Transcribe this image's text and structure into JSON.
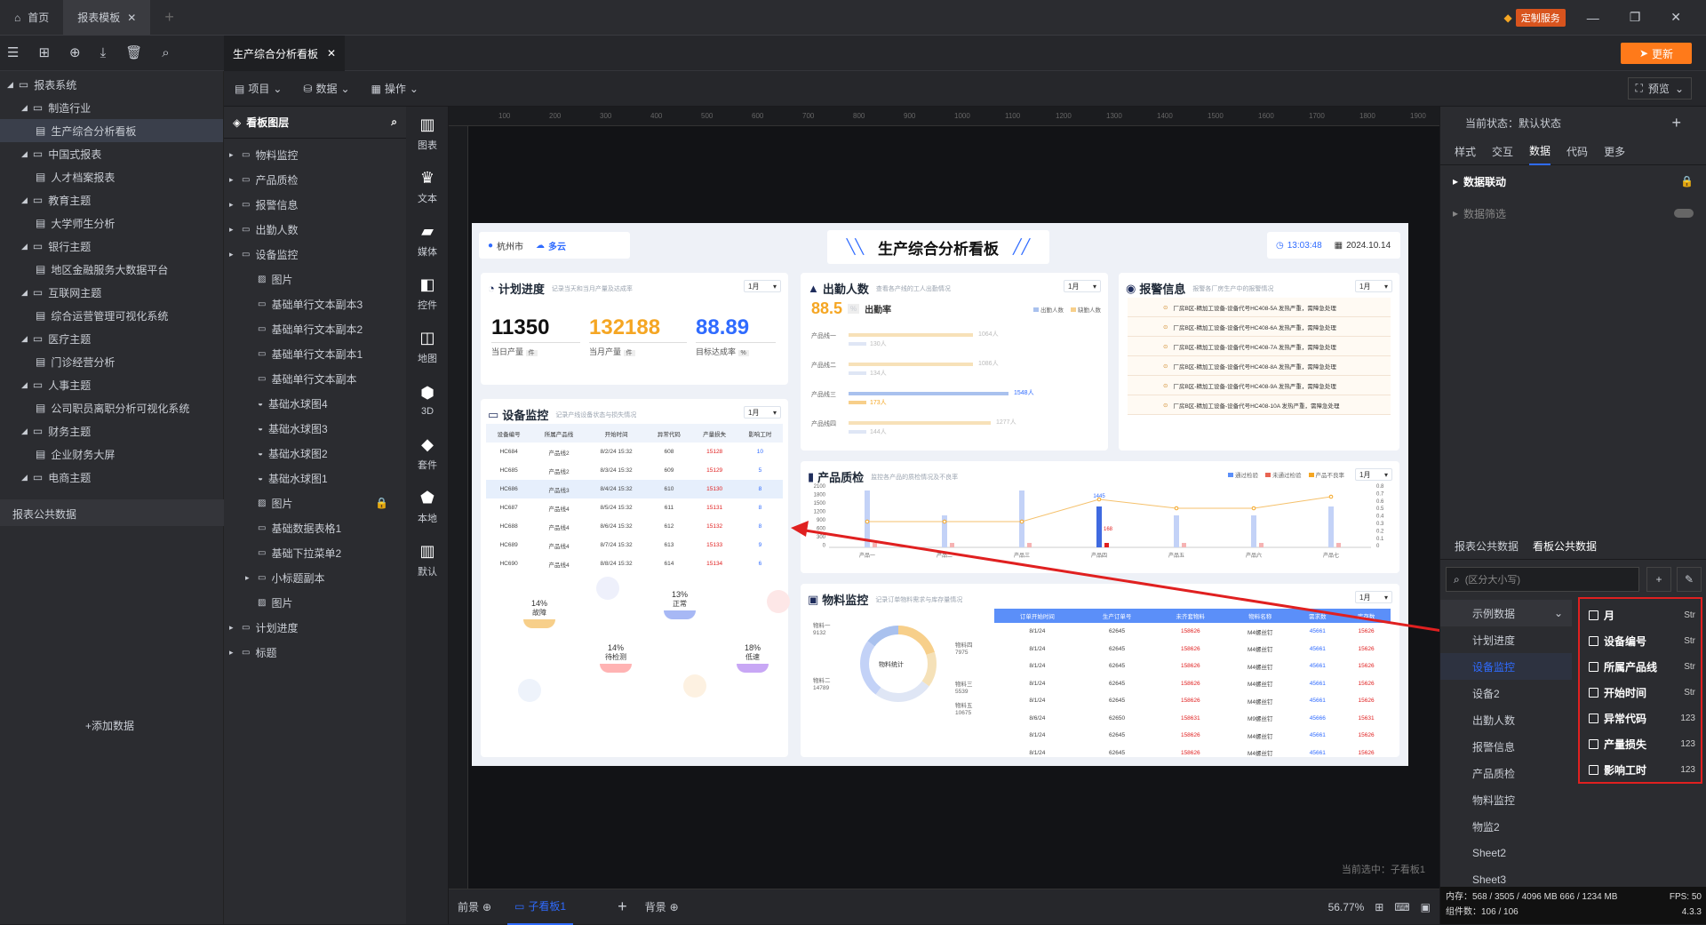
{
  "titlebar": {
    "tab_home": "首页",
    "tab_report": "报表模板",
    "custom_service": "定制服务"
  },
  "toolbar": {
    "doc_tab": "生产综合分析看板",
    "menu_project": "项目",
    "menu_data": "数据",
    "menu_operate": "操作",
    "update": "更新",
    "preview": "预览"
  },
  "tree": [
    {
      "label": "报表系统",
      "level": 0
    },
    {
      "label": "制造行业",
      "level": 1
    },
    {
      "label": "生产综合分析看板",
      "level": 2,
      "selected": true
    },
    {
      "label": "中国式报表",
      "level": 1
    },
    {
      "label": "人才档案报表",
      "level": 2
    },
    {
      "label": "教育主题",
      "level": 1
    },
    {
      "label": "大学师生分析",
      "level": 2
    },
    {
      "label": "银行主题",
      "level": 1
    },
    {
      "label": "地区金融服务大数据平台",
      "level": 2
    },
    {
      "label": "互联网主题",
      "level": 1
    },
    {
      "label": "综合运营管理可视化系统",
      "level": 2
    },
    {
      "label": "医疗主题",
      "level": 1
    },
    {
      "label": "门诊经营分析",
      "level": 2
    },
    {
      "label": "人事主题",
      "level": 1
    },
    {
      "label": "公司职员离职分析可视化系统",
      "level": 2
    },
    {
      "label": "财务主题",
      "level": 1
    },
    {
      "label": "企业财务大屏",
      "level": 2
    },
    {
      "label": "电商主题",
      "level": 1
    }
  ],
  "public_data": {
    "title": "报表公共数据",
    "add": "+添加数据"
  },
  "layers": {
    "title": "看板图层",
    "items": [
      "物料监控",
      "产品质检",
      "报警信息",
      "出勤人数",
      "设备监控",
      "图片",
      "基础单行文本副本3",
      "基础单行文本副本2",
      "基础单行文本副本1",
      "基础单行文本副本",
      "基础水球图4",
      "基础水球图3",
      "基础水球图2",
      "基础水球图1",
      "图片",
      "基础数据表格1",
      "基础下拉菜单2",
      "小标题副本",
      "图片",
      "计划进度",
      "标题"
    ]
  },
  "rail": [
    "图表",
    "文本",
    "媒体",
    "控件",
    "地图",
    "3D",
    "套件",
    "本地",
    "默认"
  ],
  "ruler": [
    "100",
    "200",
    "300",
    "400",
    "500",
    "600",
    "700",
    "800",
    "900",
    "1000",
    "1100",
    "1200",
    "1300",
    "1400",
    "1500",
    "1600",
    "1700",
    "1800",
    "1900"
  ],
  "dashboard": {
    "city": "杭州市",
    "weather": "多云",
    "title": "生产综合分析看板",
    "time": "13:03:48",
    "date": "2024.10.14",
    "month": "1月",
    "plan": {
      "title": "计划进度",
      "sub": "记录当天和当月产量及达成率",
      "v1": "11350",
      "l1": "当日产量",
      "u1": "件",
      "v2": "132188",
      "l2": "当月产量",
      "u2": "件",
      "v3": "88.89",
      "l3": "目标达成率",
      "u3": "%"
    },
    "attend": {
      "title": "出勤人数",
      "sub": "查看各产线的工人出勤情况",
      "rate": "88.5",
      "unit": "%",
      "rate_label": "出勤率",
      "legend1": "出勤人数",
      "legend2": "缺勤人数",
      "lines": [
        {
          "name": "产品线一",
          "a": "1064人",
          "b": "130人"
        },
        {
          "name": "产品线二",
          "a": "1086人",
          "b": "134人"
        },
        {
          "name": "产品线三",
          "a": "1548人",
          "b": "173人"
        },
        {
          "name": "产品线四",
          "a": "1277人",
          "b": "144人"
        }
      ]
    },
    "alarm": {
      "title": "报警信息",
      "sub": "报警各厂房生产中的报警情况",
      "items": [
        "厂房B区-精加工设备-设备代号HC408-5A 发热严重，需障急处理",
        "厂房B区-精加工设备-设备代号HC408-6A 发热严重，需障急处理",
        "厂房B区-精加工设备-设备代号HC408-7A 发热严重，需障急处理",
        "厂房B区-精加工设备-设备代号HC408-8A 发热严重，需障急处理",
        "厂房B区-精加工设备-设备代号HC408-9A 发热严重，需障急处理",
        "厂房B区-精加工设备-设备代号HC408-10A 发热严重，需障急处理"
      ]
    },
    "equip": {
      "title": "设备监控",
      "sub": "记录产线设备状态与损失情况",
      "headers": [
        "设备编号",
        "所属产品线",
        "开始时间",
        "异常代码",
        "产量损失",
        "影响工时"
      ],
      "rows": [
        [
          "HC684",
          "产品线2",
          "8/2/24 15:32",
          "608",
          "15128",
          "10"
        ],
        [
          "HC685",
          "产品线2",
          "8/3/24 15:32",
          "609",
          "15129",
          "5"
        ],
        [
          "HC686",
          "产品线3",
          "8/4/24 15:32",
          "610",
          "15130",
          "8"
        ],
        [
          "HC687",
          "产品线4",
          "8/5/24 15:32",
          "611",
          "15131",
          "8"
        ],
        [
          "HC688",
          "产品线4",
          "8/6/24 15:32",
          "612",
          "15132",
          "8"
        ],
        [
          "HC689",
          "产品线4",
          "8/7/24 15:32",
          "613",
          "15133",
          "9"
        ],
        [
          "HC690",
          "产品线4",
          "8/8/24 15:32",
          "614",
          "15134",
          "6"
        ]
      ],
      "balls": [
        {
          "pct": "14%",
          "name": "故障"
        },
        {
          "pct": "13%",
          "name": "正常"
        },
        {
          "pct": "14%",
          "name": "待检测"
        },
        {
          "pct": "18%",
          "name": "低速"
        }
      ]
    },
    "quality": {
      "title": "产品质检",
      "sub": "监控各产品的质检情况及不良率",
      "legend": [
        "通过检验",
        "未通过检验",
        "产品不良率"
      ],
      "ann1": "1445",
      "ann2": "168",
      "yticks": [
        "2100",
        "1800",
        "1500",
        "1200",
        "900",
        "600",
        "300",
        "0"
      ],
      "y2ticks": [
        "0.8",
        "0.7",
        "0.6",
        "0.5",
        "0.4",
        "0.3",
        "0.2",
        "0.1",
        "0"
      ],
      "categories": [
        "产品一",
        "产品二",
        "产品三",
        "产品四",
        "产品五",
        "产品六",
        "产品七"
      ]
    },
    "material": {
      "title": "物料监控",
      "sub": "记录订单物料需求与库存量情况",
      "center": "物料统计",
      "headers": [
        "订单开始时间",
        "生产订单号",
        "未齐套物料",
        "物料名称",
        "需求数",
        "库存数"
      ],
      "rows": [
        [
          "8/1/24",
          "62645",
          "158626",
          "M4螺丝钉",
          "45661",
          "15626"
        ],
        [
          "8/1/24",
          "62645",
          "158626",
          "M4螺丝钉",
          "45661",
          "15626"
        ],
        [
          "8/1/24",
          "62645",
          "158626",
          "M4螺丝钉",
          "45661",
          "15626"
        ],
        [
          "8/1/24",
          "62645",
          "158626",
          "M4螺丝钉",
          "45661",
          "15626"
        ],
        [
          "8/1/24",
          "62645",
          "158626",
          "M4螺丝钉",
          "45661",
          "15626"
        ],
        [
          "8/6/24",
          "62650",
          "158631",
          "M9螺丝钉",
          "45666",
          "15631"
        ],
        [
          "8/1/24",
          "62645",
          "158626",
          "M4螺丝钉",
          "45661",
          "15626"
        ],
        [
          "8/1/24",
          "62645",
          "158626",
          "M4螺丝钉",
          "45661",
          "15626"
        ]
      ],
      "labels": [
        {
          "n": "物料一",
          "v": "9132"
        },
        {
          "n": "物料二",
          "v": "14789"
        },
        {
          "n": "物料四",
          "v": "7975"
        },
        {
          "n": "物料三",
          "v": "5539"
        },
        {
          "n": "物料五",
          "v": "10675"
        }
      ]
    }
  },
  "right": {
    "state": "当前状态：默认状态",
    "tabs": [
      "样式",
      "交互",
      "数据",
      "代码",
      "更多"
    ],
    "linkage": "数据联动",
    "filter": "数据筛选",
    "tab_a": "报表公共数据",
    "tab_b": "看板公共数据",
    "search_ph": "(区分大小写)",
    "datasets": [
      "示例数据",
      "计划进度",
      "设备监控",
      "设备2",
      "出勤人数",
      "报警信息",
      "产品质检",
      "物料监控",
      "物监2",
      "Sheet2",
      "Sheet3"
    ],
    "fields": [
      {
        "name": "月",
        "type": "Str"
      },
      {
        "name": "设备编号",
        "type": "Str"
      },
      {
        "name": "所属产品线",
        "type": "Str"
      },
      {
        "name": "开始时间",
        "type": "Str"
      },
      {
        "name": "异常代码",
        "type": "123"
      },
      {
        "name": "产量损失",
        "type": "123"
      },
      {
        "name": "影响工时",
        "type": "123"
      }
    ],
    "mem": "内存：568 / 3505 / 4096 MB  666 / 1234 MB",
    "fps": "FPS: 50",
    "count": "组件数：106 / 106",
    "version": "4.3.3"
  },
  "bottom": {
    "front": "前景",
    "sub": "子看板1",
    "back": "背景",
    "zoom": "56.77%",
    "selected": "当前选中：子看板1"
  },
  "colors": {
    "accent": "#2f6bff",
    "orange": "#f5a623",
    "red": "#e02020"
  }
}
